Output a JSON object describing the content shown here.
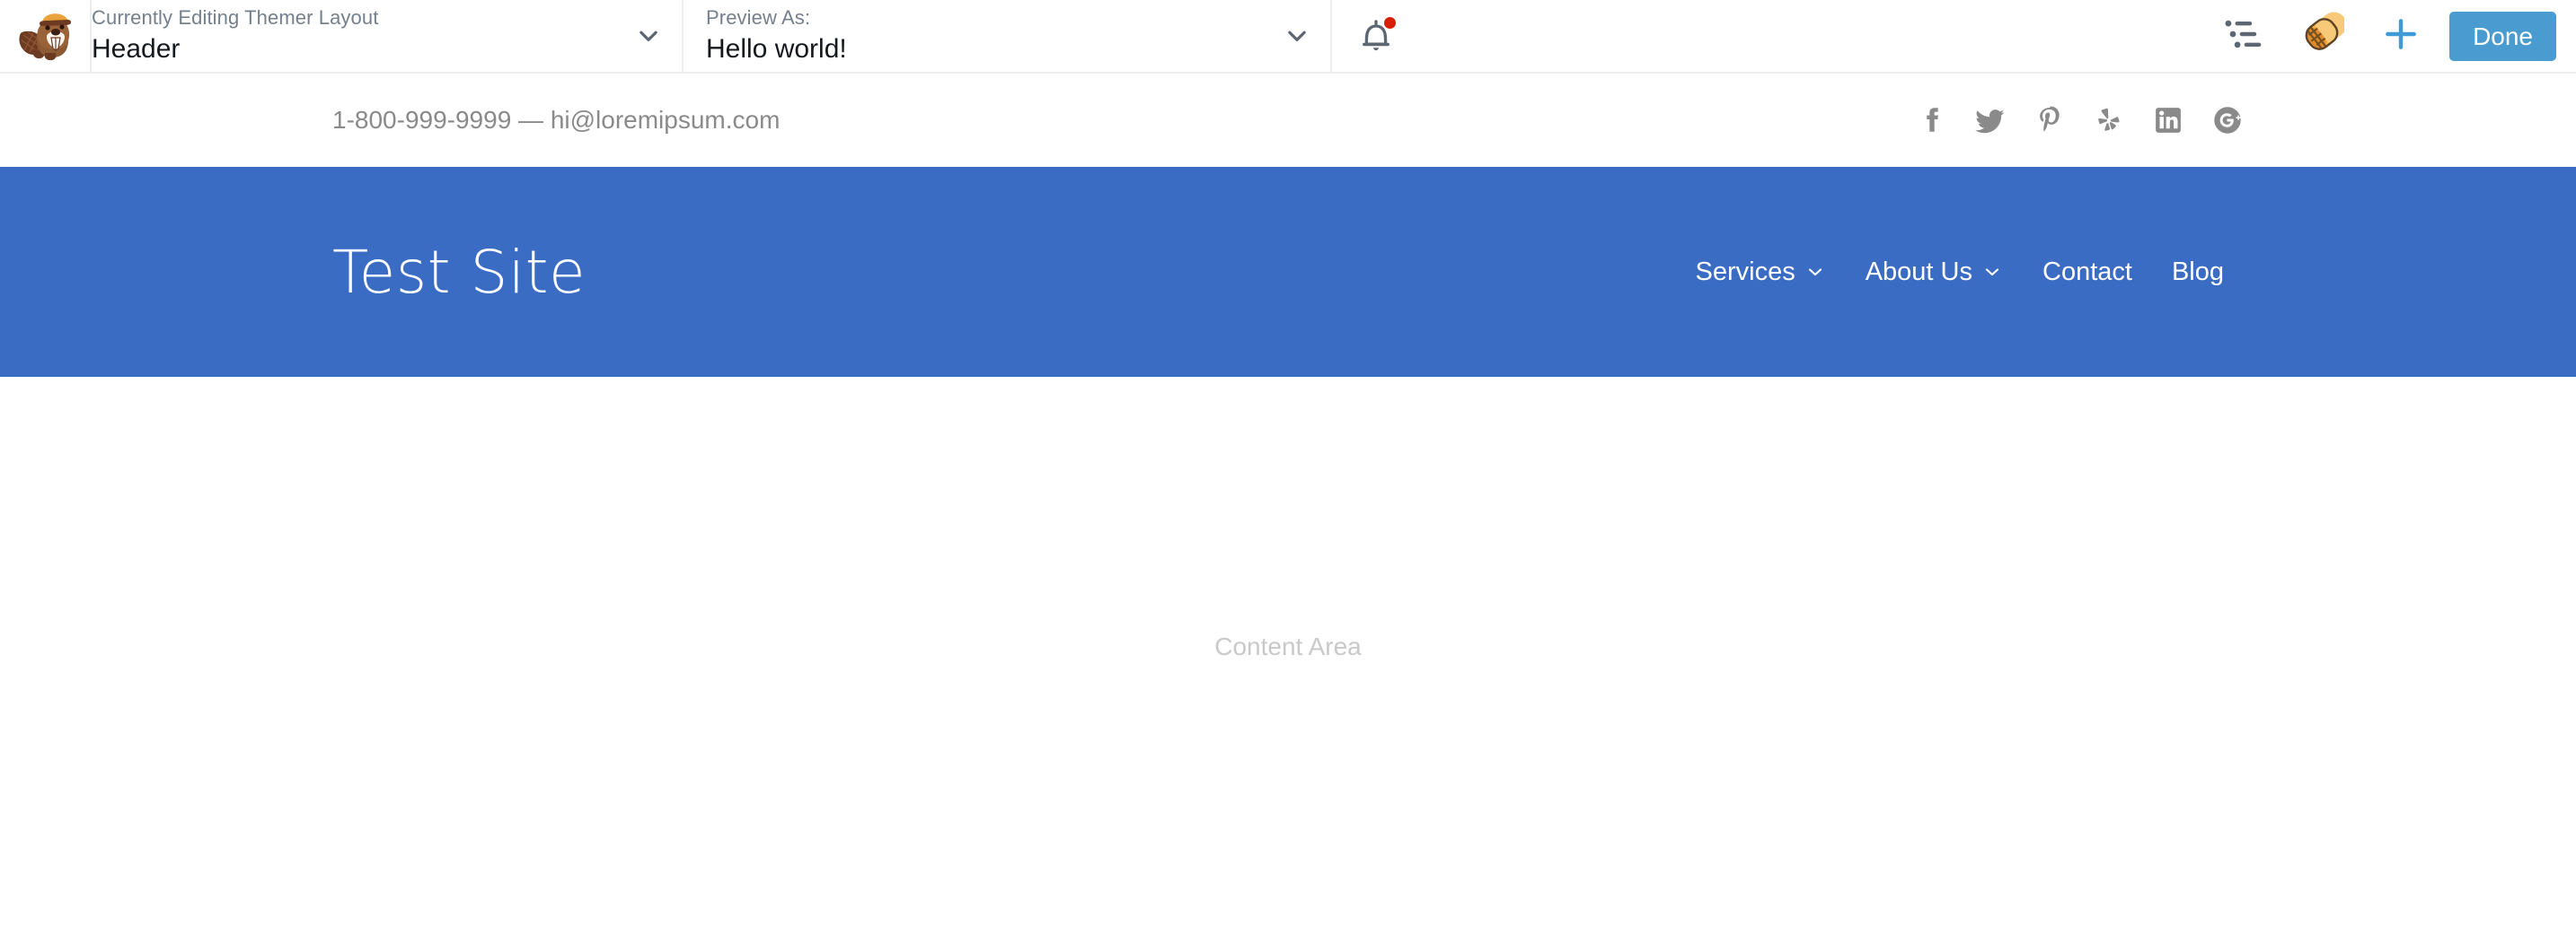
{
  "admin_bar": {
    "logo_icon": "beaver-logo-icon",
    "editing_selector": {
      "label": "Currently Editing Themer Layout",
      "value": "Header",
      "chevron_icon": "chevron-down-icon"
    },
    "preview_selector": {
      "label": "Preview As:",
      "value": "Hello world!",
      "chevron_icon": "chevron-down-icon"
    },
    "notifications": {
      "icon": "bell-icon",
      "has_unread": true,
      "dot_color": "#d81e06"
    },
    "tools": [
      {
        "name": "outline-panel-icon",
        "icon": "outline-list-icon"
      },
      {
        "name": "tools-icon",
        "icon": "beaver-tail-waffle-icon"
      },
      {
        "name": "add-content-icon",
        "icon": "plus-icon"
      }
    ],
    "done_label": "Done",
    "done_color": "#4a9cd0"
  },
  "topbar": {
    "contact_info": "1-800-999-9999 — hi@loremipsum.com",
    "social_icons": [
      {
        "name": "facebook-icon",
        "label": "Facebook"
      },
      {
        "name": "twitter-icon",
        "label": "Twitter"
      },
      {
        "name": "pinterest-icon",
        "label": "Pinterest"
      },
      {
        "name": "yelp-icon",
        "label": "Yelp"
      },
      {
        "name": "linkedin-icon",
        "label": "LinkedIn"
      },
      {
        "name": "googleplus-icon",
        "label": "Google Plus"
      }
    ]
  },
  "site_header": {
    "title": "Test Site",
    "background_color": "#3a6cc4",
    "nav": [
      {
        "label": "Services",
        "has_dropdown": true
      },
      {
        "label": "About Us",
        "has_dropdown": true
      },
      {
        "label": "Contact",
        "has_dropdown": false
      },
      {
        "label": "Blog",
        "has_dropdown": false
      }
    ]
  },
  "content": {
    "placeholder": "Content Area"
  }
}
